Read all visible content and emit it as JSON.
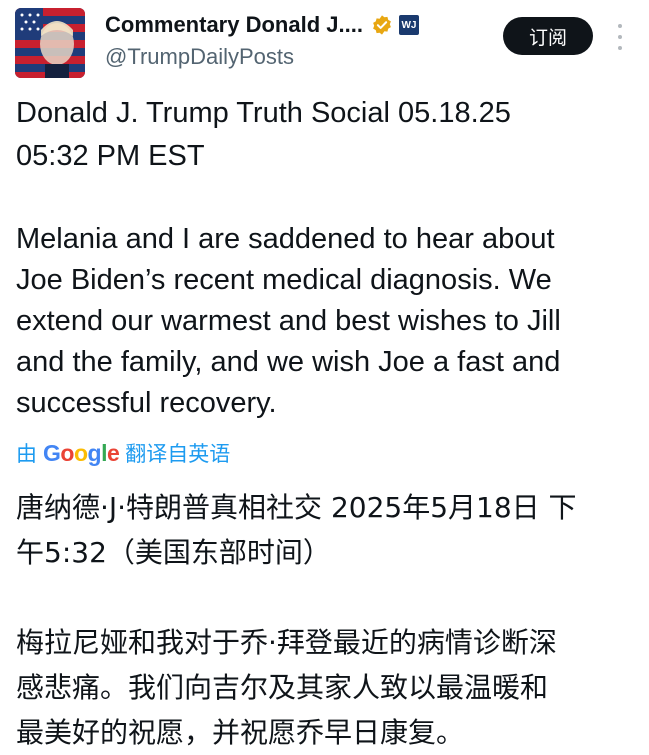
{
  "header": {
    "display_name": "Commentary Donald J....",
    "handle": "@TrumpDailyPosts",
    "badge_text": "WJ",
    "subscribe_label": "订阅",
    "avatar_icon": "flag-portrait-avatar",
    "verified_icon": "verified-gold-badge-icon",
    "more_icon": "more-vertical-icon"
  },
  "post": {
    "title": "Donald J. Trump Truth Social 05.18.25\n05:32 PM EST",
    "body_en": "Melania and I are saddened to hear about\nJoe Biden’s recent medical diagnosis. We\nextend our warmest and best wishes to Jill\nand the family, and we wish Joe a fast and\nsuccessful recovery.",
    "translate_prefix": "由",
    "translate_suffix": "翻译自英语",
    "body_zh": "唐纳德·J·特朗普真相社交 2025年5月18日 下\n午5:32（美国东部时间）\n\n梅拉尼娅和我对于乔·拜登最近的病情诊断深\n感悲痛。我们向吉尔及其家人致以最温暖和\n最美好的祝愿，并祝愿乔早日康复。"
  },
  "colors": {
    "link": "#1d9bf0",
    "secondary_text": "#536471",
    "button_bg": "#0f1419",
    "verified": "#e8a712"
  }
}
